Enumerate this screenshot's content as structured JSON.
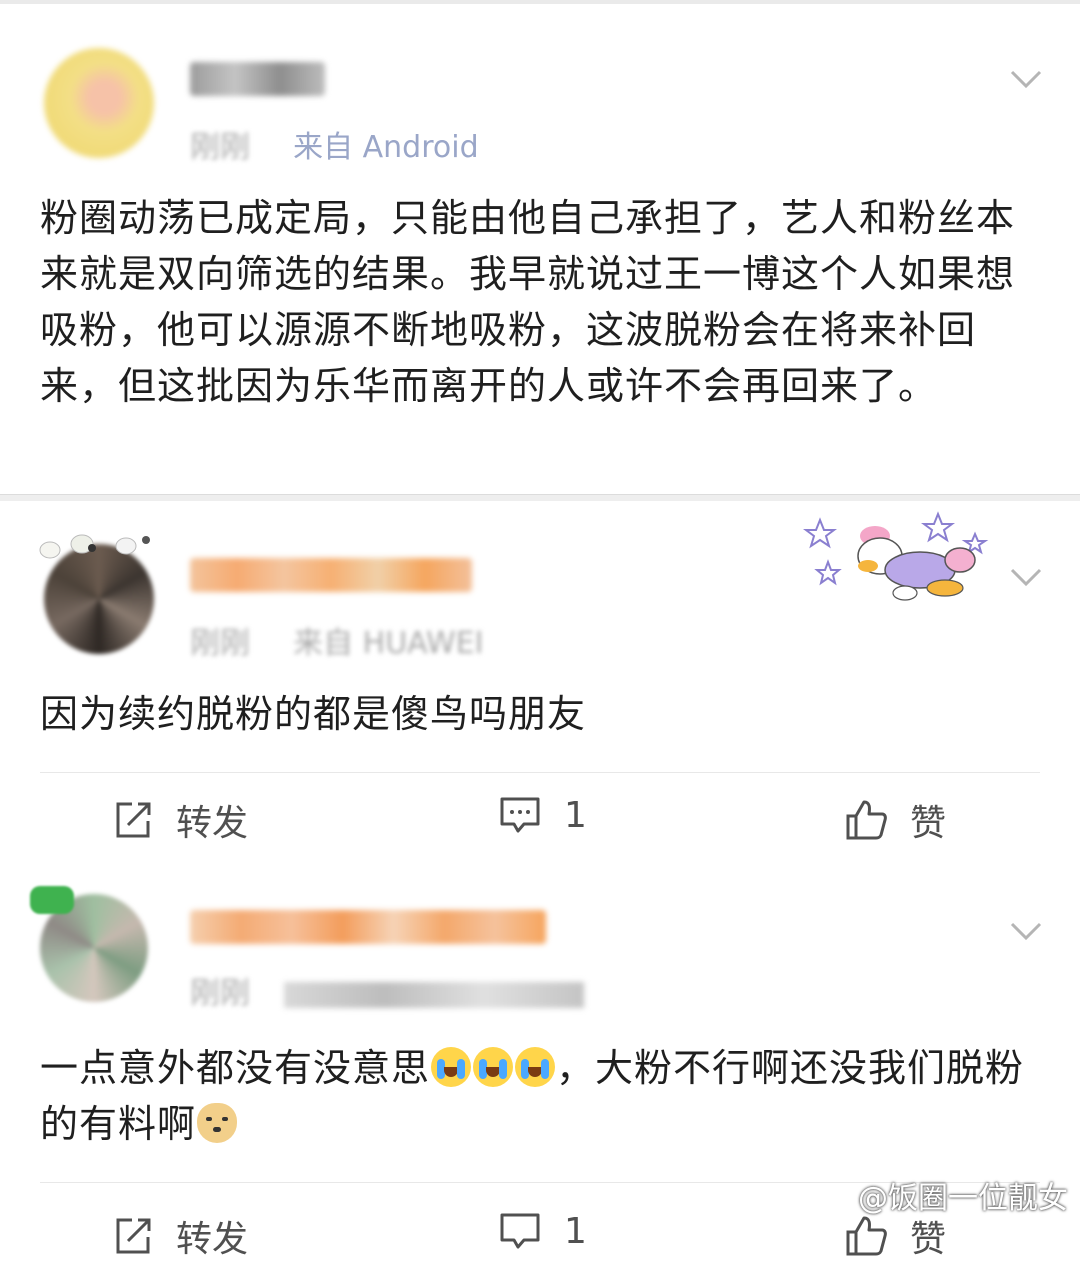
{
  "posts": [
    {
      "meta_prefix": "刚刚",
      "meta_source": "来自 Android",
      "content": "粉圈动荡已成定局，只能由他自己承担了，艺人和粉丝本来就是双向筛选的结果。我早就说过王一博这个人如果想吸粉，他可以源源不断地吸粉，这波脱粉会在将来补回来，但这批因为乐华而离开的人或许不会再回来了。"
    },
    {
      "meta_prefix": "刚刚",
      "meta_source": "来自 HUAWEI",
      "content": "因为续约脱粉的都是傻鸟吗朋友",
      "actions": {
        "repost": "转发",
        "comment": "1",
        "like": "赞"
      }
    },
    {
      "meta_prefix": "刚刚",
      "content_part1": "一点意外都没有没意思",
      "content_part2": "，大粉不行啊还没我们",
      "content_part3": "脱粉的有料啊",
      "actions": {
        "repost": "转发",
        "comment": "1",
        "like": "赞"
      }
    }
  ],
  "watermark": "@饭圈一位靓女",
  "icons": [
    "chevron-down-icon",
    "repost-icon",
    "comment-icon",
    "like-icon",
    "crying-emoji",
    "doge-emoji",
    "daisy-duck-sticker"
  ],
  "colors": {
    "name_blur": "#f4b27a",
    "meta": "#a9a9a9",
    "text": "#1f1f1f",
    "action": "#505050"
  }
}
